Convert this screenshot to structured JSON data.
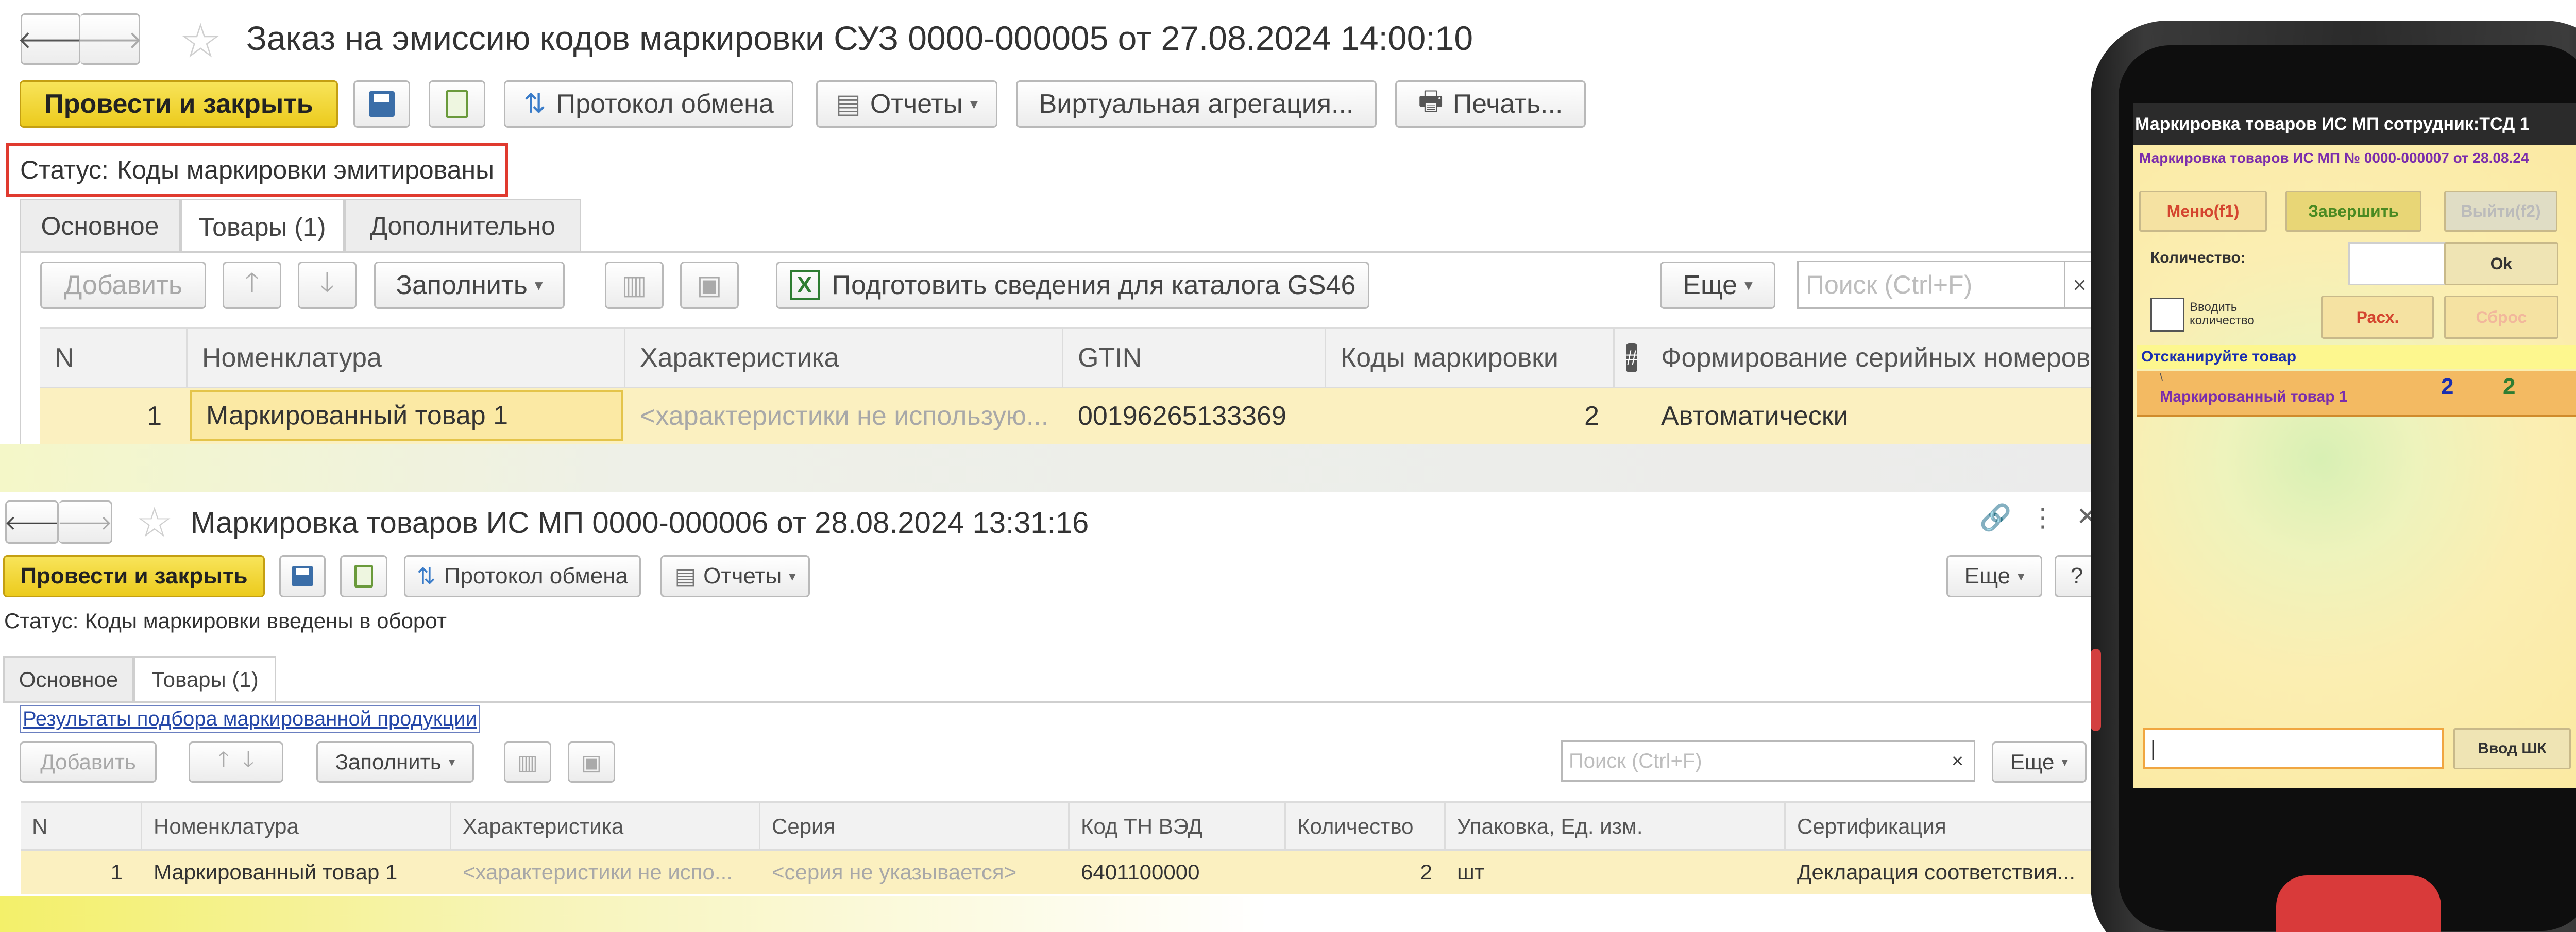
{
  "w1": {
    "title": "Заказ на эмиссию кодов маркировки СУЗ 0000-000005 от 27.08.2024 14:00:10",
    "toolbar": {
      "post_close": "Провести и закрыть",
      "exchange_protocol": "Протокол обмена",
      "reports": "Отчеты",
      "virtual_aggregation": "Виртуальная агрегация...",
      "print": "Печать..."
    },
    "status_label": "Статус:",
    "status_value": "Коды маркировки эмитированы",
    "tabs": [
      "Основное",
      "Товары (1)",
      "Дополнительно"
    ],
    "table_toolbar": {
      "add": "Добавить",
      "fill": "Заполнить",
      "prepare_gs46": "Подготовить сведения для каталога GS46",
      "more": "Еще",
      "search_placeholder": "Поиск (Ctrl+F)",
      "clear": "×"
    },
    "columns": [
      "N",
      "Номенклатура",
      "Характеристика",
      "GTIN",
      "Коды маркировки",
      "#",
      "Формирование серийных номеров"
    ],
    "rows": [
      {
        "n": "1",
        "nomenclature": "Маркированный товар 1",
        "characteristic": "<характеристики не использую...",
        "gtin": "00196265133369",
        "codes": "2",
        "serial": "Автоматически"
      }
    ]
  },
  "w2": {
    "title": "Маркировка товаров ИС МП 0000-000006 от 28.08.2024 13:31:16",
    "toolbar": {
      "post_close": "Провести и закрыть",
      "exchange_protocol": "Протокол обмена",
      "reports": "Отчеты",
      "more": "Еще",
      "help": "?"
    },
    "status_label": "Статус:",
    "status_value": "Коды маркировки введены в оборот",
    "tabs": [
      "Основное",
      "Товары (1)"
    ],
    "results_link": "Результаты подбора маркированной продукции",
    "table_toolbar": {
      "add": "Добавить",
      "fill": "Заполнить",
      "search_placeholder": "Поиск (Ctrl+F)",
      "clear": "×",
      "more": "Еще"
    },
    "columns": [
      "N",
      "Номенклатура",
      "Характеристика",
      "Серия",
      "Код ТН ВЭД",
      "Количество",
      "Упаковка, Ед. изм.",
      "Сертификация"
    ],
    "rows": [
      {
        "n": "1",
        "nomenclature": "Маркированный товар 1",
        "characteristic": "<характеристики не испо...",
        "series": "<серия не указывается>",
        "tnved": "6401100000",
        "qty": "2",
        "unit": "шт",
        "cert": "Декларация соответствия..."
      }
    ]
  },
  "phone": {
    "title": "Маркировка товаров ИС МП сотрудник:ТСД 1",
    "subtitle": "Маркировка товаров ИС МП № 0000-000007 от 28.08.24",
    "buttons": {
      "menu": "Меню(f1)",
      "finish": "Завершить",
      "exit": "Выйти(f2)",
      "ok": "Ok",
      "discrepancy": "Расх.",
      "reset": "Сброс",
      "enter_barcode": "Ввод ШК"
    },
    "quantity_label": "Количество:",
    "enter_qty_label": "Вводить количество",
    "scan_prompt": "Отсканируйте товар",
    "item": {
      "mark": "\\",
      "name": "Маркированный товар 1",
      "required": "2",
      "scanned": "2"
    },
    "bottom_input_value": "|"
  },
  "colors": {
    "primary_button": "#eccb1d",
    "row_highlight": "#fbf0c0",
    "status_outline": "#e03a2f",
    "phone_accent": "#f3ba62",
    "phone_title_purple": "#7b2dac",
    "phone_scan_blue": "#1a2fb0"
  }
}
